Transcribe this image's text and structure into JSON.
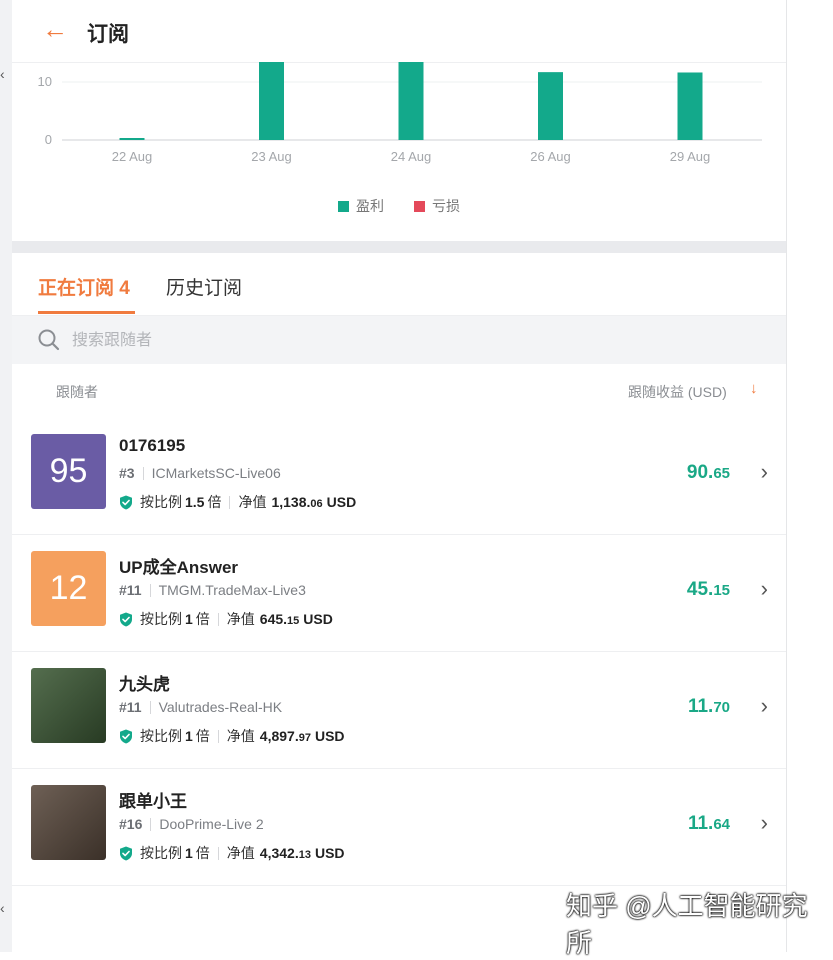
{
  "header": {
    "back_icon": "arrow-left-icon",
    "title": "订阅"
  },
  "chart_data": {
    "type": "bar",
    "categories": [
      "22 Aug",
      "23 Aug",
      "24 Aug",
      "26 Aug",
      "29 Aug"
    ],
    "series": [
      {
        "name": "盈利",
        "color": "#13a98b",
        "values": [
          0.3,
          45.15,
          90.65,
          11.7,
          11.64
        ]
      },
      {
        "name": "亏损",
        "color": "#e4495a",
        "values": [
          0,
          0,
          0,
          0,
          0
        ]
      }
    ],
    "yticks": [
      0,
      10
    ],
    "ylabel": "",
    "xlabel": "",
    "legend": "bottom"
  },
  "tabs": {
    "active_label": "正在订阅",
    "active_count": "4",
    "history_label": "历史订阅"
  },
  "search": {
    "placeholder": "搜索跟随者",
    "icon": "search-icon"
  },
  "columns": {
    "follower": "跟随者",
    "profit": "跟随收益 (USD)",
    "sort_icon": "arrow-down-icon"
  },
  "followers": [
    {
      "avatar_text": "95",
      "avatar_color": "#6a5ca5",
      "name": "0176195",
      "rank": "#3",
      "account": "ICMarketsSC-Live06",
      "ratio_label": "按比例",
      "ratio": "1.5",
      "ratio_unit": "倍",
      "equity_label": "净值",
      "equity_main": "1,138.",
      "equity_dec": "06",
      "currency": "USD",
      "profit_main": "90.",
      "profit_dec": "65"
    },
    {
      "avatar_text": "12",
      "avatar_color": "#f5a05e",
      "name": "UP成全Answer",
      "rank": "#11",
      "account": "TMGM.TradeMax-Live3",
      "ratio_label": "按比例",
      "ratio": "1",
      "ratio_unit": "倍",
      "equity_label": "净值",
      "equity_main": "645.",
      "equity_dec": "15",
      "currency": "USD",
      "profit_main": "45.",
      "profit_dec": "15"
    },
    {
      "avatar_text": "",
      "avatar_color": "#3d5a36",
      "name": "九头虎",
      "rank": "#11",
      "account": "Valutrades-Real-HK",
      "ratio_label": "按比例",
      "ratio": "1",
      "ratio_unit": "倍",
      "equity_label": "净值",
      "equity_main": "4,897.",
      "equity_dec": "97",
      "currency": "USD",
      "profit_main": "11.",
      "profit_dec": "70"
    },
    {
      "avatar_text": "",
      "avatar_color": "#5a4a3e",
      "name": "跟单小王",
      "rank": "#16",
      "account": "DooPrime-Live 2",
      "ratio_label": "按比例",
      "ratio": "1",
      "ratio_unit": "倍",
      "equity_label": "净值",
      "equity_main": "4,342.",
      "equity_dec": "13",
      "currency": "USD",
      "profit_main": "11.",
      "profit_dec": "64"
    }
  ],
  "watermark": "知乎 @人工智能研究所"
}
